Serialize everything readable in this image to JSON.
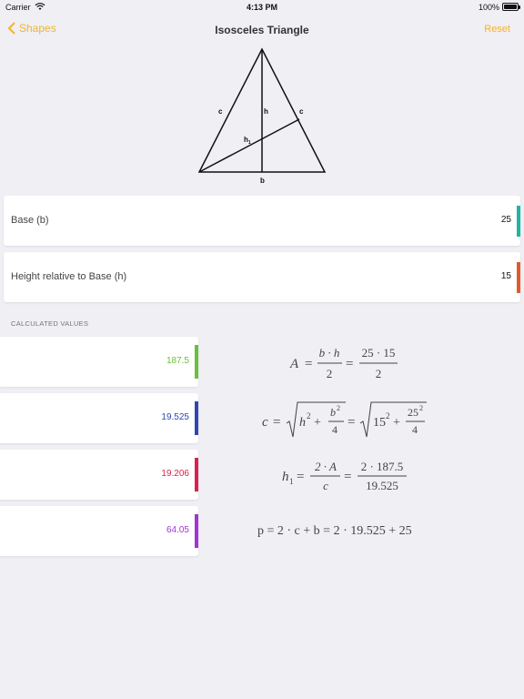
{
  "status_bar": {
    "carrier": "Carrier",
    "time": "4:13 PM",
    "battery": "100%"
  },
  "nav": {
    "back_label": "Shapes",
    "title": "Isosceles Triangle",
    "reset_label": "Reset"
  },
  "diagram": {
    "labels": {
      "left_side": "c",
      "height": "h",
      "right_side": "c",
      "h1": "h",
      "h1_sub": "1",
      "base": "b"
    }
  },
  "inputs": [
    {
      "label": "Base (b)",
      "value": "25",
      "accent": "#1fb5a5"
    },
    {
      "label": "Height relative to Base (h)",
      "value": "15",
      "accent": "#e05a2e"
    }
  ],
  "calculated_header": "CALCULATED VALUES",
  "results": [
    {
      "value": "187.5",
      "color": "#6cbf3a"
    },
    {
      "value": "19.525",
      "color": "#2e48b0"
    },
    {
      "value": "19.206",
      "color": "#d9204f"
    },
    {
      "value": "64.05",
      "color": "#a333d6"
    }
  ],
  "formulas": {
    "area": {
      "lhs": "A",
      "eq": "=",
      "n1": "b · h",
      "d1": "2",
      "n2": "25 · 15",
      "d2": "2"
    },
    "side": {
      "lhs": "c",
      "eq": "=",
      "h": "h",
      "sq": "2",
      "plus": "+",
      "b": "b",
      "d": "4",
      "n15": "15",
      "n25": "25"
    },
    "h1": {
      "lhs": "h",
      "sub": "1",
      "eq": "=",
      "n1": "2 · A",
      "d1": "c",
      "n2": "2 · 187.5",
      "d2": "19.525"
    },
    "perimeter": {
      "text": "p = 2 · c + b = 2 · 19.525 + 25"
    }
  }
}
